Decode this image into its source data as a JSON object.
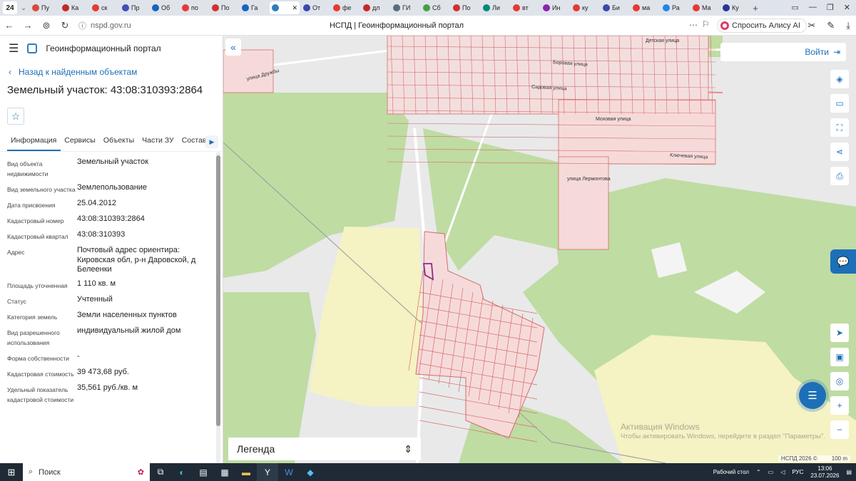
{
  "browser": {
    "tab_count": "24",
    "tabs": [
      {
        "label": "Пу",
        "color": "#d94a3b"
      },
      {
        "label": "Ка",
        "color": "#c62828"
      },
      {
        "label": "ск",
        "color": "#e53935"
      },
      {
        "label": "Пр",
        "color": "#3f51b5"
      },
      {
        "label": "Об",
        "color": "#1565c0"
      },
      {
        "label": "по",
        "color": "#e53935"
      },
      {
        "label": "По",
        "color": "#d32f2f"
      },
      {
        "label": "Га",
        "color": "#1565c0"
      },
      {
        "label": "",
        "color": "#2d7fb8",
        "active": true
      },
      {
        "label": "От",
        "color": "#3949ab"
      },
      {
        "label": "фе",
        "color": "#e53935"
      },
      {
        "label": "дл",
        "color": "#c62828"
      },
      {
        "label": "ГИ",
        "color": "#546e7a"
      },
      {
        "label": "Сб",
        "color": "#43a047"
      },
      {
        "label": "По",
        "color": "#d32f2f"
      },
      {
        "label": "Ли",
        "color": "#00897b"
      },
      {
        "label": "вт",
        "color": "#e53935"
      },
      {
        "label": "Ин",
        "color": "#8e24aa"
      },
      {
        "label": "ку",
        "color": "#e53935"
      },
      {
        "label": "Би",
        "color": "#3949ab"
      },
      {
        "label": "ма",
        "color": "#e53935"
      },
      {
        "label": "Ра",
        "color": "#1e88e5"
      },
      {
        "label": "Ма",
        "color": "#e53935"
      },
      {
        "label": "Ку",
        "color": "#283593"
      }
    ],
    "url": "nspd.gov.ru",
    "page_title": "НСПД | Геоинформационный портал",
    "alisa_label": "Спросить Алису AI"
  },
  "sidebar": {
    "portal_title": "Геоинформационный портал",
    "back_label": "Назад к найденным объектам",
    "object_title": "Земельный участок: 43:08:310393:2864",
    "tabs": [
      "Информация",
      "Сервисы",
      "Объекты",
      "Части ЗУ",
      "Состав"
    ],
    "properties": [
      {
        "key": "Вид объекта недвижимости",
        "value": "Земельный участок"
      },
      {
        "key": "Вид земельного участка",
        "value": "Землепользование"
      },
      {
        "key": "Дата присвоения",
        "value": "25.04.2012"
      },
      {
        "key": "Кадастровый номер",
        "value": "43:08:310393:2864"
      },
      {
        "key": "Кадастровый квартал",
        "value": "43:08:310393"
      },
      {
        "key": "Адрес",
        "value": "Почтовый адрес ориентира: Кировская обл, р-н Даровской, д Белеенки"
      },
      {
        "key": "Площадь уточненная",
        "value": "1 110 кв. м"
      },
      {
        "key": "Статус",
        "value": "Учтенный"
      },
      {
        "key": "Категория земель",
        "value": "Земли населенных пунктов"
      },
      {
        "key": "Вид разрешенного использования",
        "value": "индивидуальный жилой дом"
      },
      {
        "key": "Форма собственности",
        "value": "-"
      },
      {
        "key": "Кадастровая стоимость",
        "value": "39 473,68 руб."
      },
      {
        "key": "Удельный показатель кадастровой стоимости",
        "value": "35,561 руб./кв. м"
      }
    ]
  },
  "map": {
    "login_label": "Войти",
    "legend_label": "Легенда",
    "streets": [
      "улица Дружбы",
      "Детская улица",
      "Боровая улица",
      "Садовая улица",
      "Моховая улица",
      "Ключевая улица",
      "улица Лермонтова"
    ],
    "watermark_title": "Активация Windows",
    "watermark_text": "Чтобы активировать Windows, перейдите в раздел \"Параметры\".",
    "copyright": "НСПД 2026 ©",
    "scale_label": "100 m"
  },
  "taskbar": {
    "search_label": "Поиск",
    "desktop_label": "Рабочий стол",
    "lang": "РУС",
    "time": "13:06",
    "date": "23.07.2026"
  }
}
